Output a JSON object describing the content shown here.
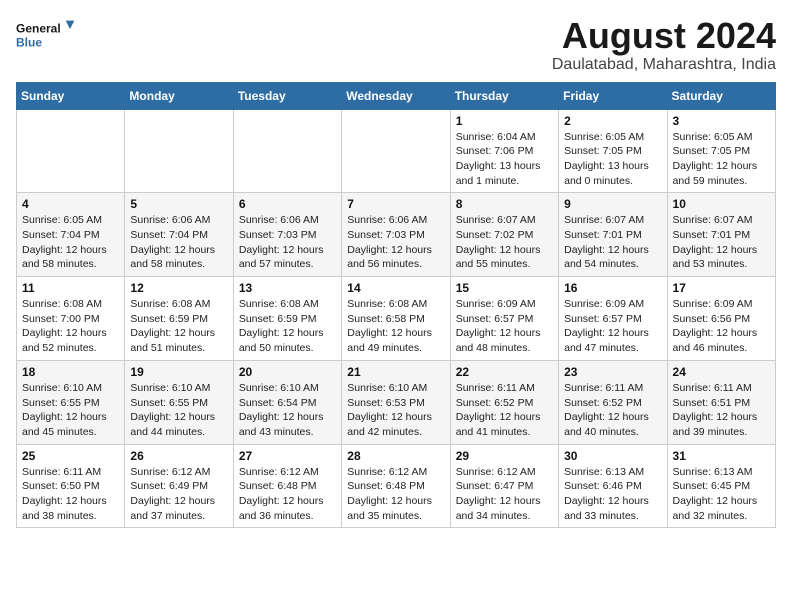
{
  "logo": {
    "line1": "General",
    "line2": "Blue"
  },
  "title": "August 2024",
  "subtitle": "Daulatabad, Maharashtra, India",
  "days_of_week": [
    "Sunday",
    "Monday",
    "Tuesday",
    "Wednesday",
    "Thursday",
    "Friday",
    "Saturday"
  ],
  "weeks": [
    [
      {
        "day": "",
        "info": ""
      },
      {
        "day": "",
        "info": ""
      },
      {
        "day": "",
        "info": ""
      },
      {
        "day": "",
        "info": ""
      },
      {
        "day": "1",
        "info": "Sunrise: 6:04 AM\nSunset: 7:06 PM\nDaylight: 13 hours\nand 1 minute."
      },
      {
        "day": "2",
        "info": "Sunrise: 6:05 AM\nSunset: 7:05 PM\nDaylight: 13 hours\nand 0 minutes."
      },
      {
        "day": "3",
        "info": "Sunrise: 6:05 AM\nSunset: 7:05 PM\nDaylight: 12 hours\nand 59 minutes."
      }
    ],
    [
      {
        "day": "4",
        "info": "Sunrise: 6:05 AM\nSunset: 7:04 PM\nDaylight: 12 hours\nand 58 minutes."
      },
      {
        "day": "5",
        "info": "Sunrise: 6:06 AM\nSunset: 7:04 PM\nDaylight: 12 hours\nand 58 minutes."
      },
      {
        "day": "6",
        "info": "Sunrise: 6:06 AM\nSunset: 7:03 PM\nDaylight: 12 hours\nand 57 minutes."
      },
      {
        "day": "7",
        "info": "Sunrise: 6:06 AM\nSunset: 7:03 PM\nDaylight: 12 hours\nand 56 minutes."
      },
      {
        "day": "8",
        "info": "Sunrise: 6:07 AM\nSunset: 7:02 PM\nDaylight: 12 hours\nand 55 minutes."
      },
      {
        "day": "9",
        "info": "Sunrise: 6:07 AM\nSunset: 7:01 PM\nDaylight: 12 hours\nand 54 minutes."
      },
      {
        "day": "10",
        "info": "Sunrise: 6:07 AM\nSunset: 7:01 PM\nDaylight: 12 hours\nand 53 minutes."
      }
    ],
    [
      {
        "day": "11",
        "info": "Sunrise: 6:08 AM\nSunset: 7:00 PM\nDaylight: 12 hours\nand 52 minutes."
      },
      {
        "day": "12",
        "info": "Sunrise: 6:08 AM\nSunset: 6:59 PM\nDaylight: 12 hours\nand 51 minutes."
      },
      {
        "day": "13",
        "info": "Sunrise: 6:08 AM\nSunset: 6:59 PM\nDaylight: 12 hours\nand 50 minutes."
      },
      {
        "day": "14",
        "info": "Sunrise: 6:08 AM\nSunset: 6:58 PM\nDaylight: 12 hours\nand 49 minutes."
      },
      {
        "day": "15",
        "info": "Sunrise: 6:09 AM\nSunset: 6:57 PM\nDaylight: 12 hours\nand 48 minutes."
      },
      {
        "day": "16",
        "info": "Sunrise: 6:09 AM\nSunset: 6:57 PM\nDaylight: 12 hours\nand 47 minutes."
      },
      {
        "day": "17",
        "info": "Sunrise: 6:09 AM\nSunset: 6:56 PM\nDaylight: 12 hours\nand 46 minutes."
      }
    ],
    [
      {
        "day": "18",
        "info": "Sunrise: 6:10 AM\nSunset: 6:55 PM\nDaylight: 12 hours\nand 45 minutes."
      },
      {
        "day": "19",
        "info": "Sunrise: 6:10 AM\nSunset: 6:55 PM\nDaylight: 12 hours\nand 44 minutes."
      },
      {
        "day": "20",
        "info": "Sunrise: 6:10 AM\nSunset: 6:54 PM\nDaylight: 12 hours\nand 43 minutes."
      },
      {
        "day": "21",
        "info": "Sunrise: 6:10 AM\nSunset: 6:53 PM\nDaylight: 12 hours\nand 42 minutes."
      },
      {
        "day": "22",
        "info": "Sunrise: 6:11 AM\nSunset: 6:52 PM\nDaylight: 12 hours\nand 41 minutes."
      },
      {
        "day": "23",
        "info": "Sunrise: 6:11 AM\nSunset: 6:52 PM\nDaylight: 12 hours\nand 40 minutes."
      },
      {
        "day": "24",
        "info": "Sunrise: 6:11 AM\nSunset: 6:51 PM\nDaylight: 12 hours\nand 39 minutes."
      }
    ],
    [
      {
        "day": "25",
        "info": "Sunrise: 6:11 AM\nSunset: 6:50 PM\nDaylight: 12 hours\nand 38 minutes."
      },
      {
        "day": "26",
        "info": "Sunrise: 6:12 AM\nSunset: 6:49 PM\nDaylight: 12 hours\nand 37 minutes."
      },
      {
        "day": "27",
        "info": "Sunrise: 6:12 AM\nSunset: 6:48 PM\nDaylight: 12 hours\nand 36 minutes."
      },
      {
        "day": "28",
        "info": "Sunrise: 6:12 AM\nSunset: 6:48 PM\nDaylight: 12 hours\nand 35 minutes."
      },
      {
        "day": "29",
        "info": "Sunrise: 6:12 AM\nSunset: 6:47 PM\nDaylight: 12 hours\nand 34 minutes."
      },
      {
        "day": "30",
        "info": "Sunrise: 6:13 AM\nSunset: 6:46 PM\nDaylight: 12 hours\nand 33 minutes."
      },
      {
        "day": "31",
        "info": "Sunrise: 6:13 AM\nSunset: 6:45 PM\nDaylight: 12 hours\nand 32 minutes."
      }
    ]
  ]
}
